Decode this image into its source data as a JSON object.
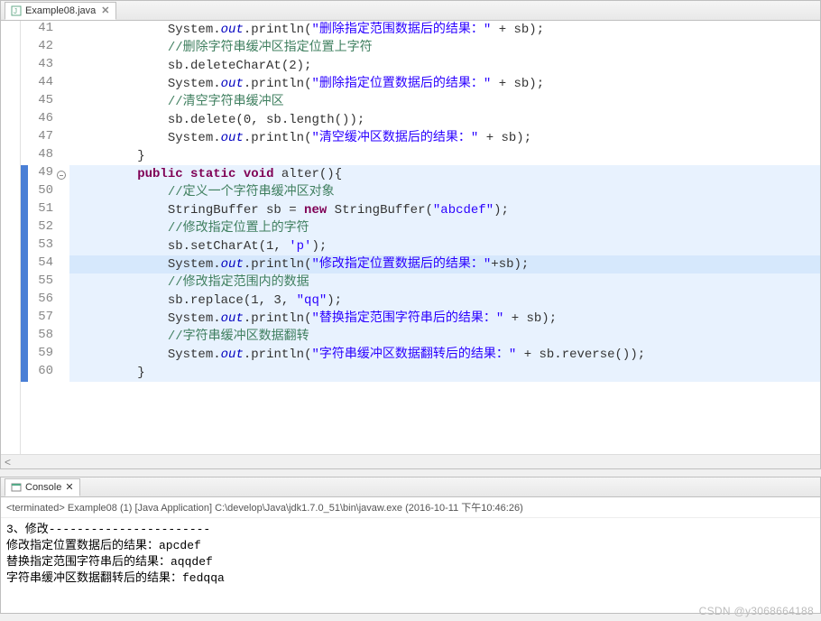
{
  "tab": {
    "filename": "Example08.java"
  },
  "code": {
    "startLine": 41,
    "highlightLines": [
      49,
      50,
      51,
      52,
      53,
      54,
      55,
      56,
      57,
      58,
      59,
      60
    ],
    "selectedLine": 54,
    "foldMarkerLine": 49,
    "lines": [
      {
        "n": 41,
        "seg": [
          {
            "t": "            System."
          },
          {
            "c": "fld",
            "t": "out"
          },
          {
            "t": ".println("
          },
          {
            "c": "str",
            "t": "\"删除指定范围数据后的结果：\""
          },
          {
            "t": " + sb);"
          }
        ]
      },
      {
        "n": 42,
        "seg": [
          {
            "t": "            "
          },
          {
            "c": "cmt",
            "t": "//删除字符串缓冲区指定位置上字符"
          }
        ]
      },
      {
        "n": 43,
        "seg": [
          {
            "t": "            sb.deleteCharAt(2);"
          }
        ]
      },
      {
        "n": 44,
        "seg": [
          {
            "t": "            System."
          },
          {
            "c": "fld",
            "t": "out"
          },
          {
            "t": ".println("
          },
          {
            "c": "str",
            "t": "\"删除指定位置数据后的结果：\""
          },
          {
            "t": " + sb);"
          }
        ]
      },
      {
        "n": 45,
        "seg": [
          {
            "t": "            "
          },
          {
            "c": "cmt",
            "t": "//清空字符串缓冲区"
          }
        ]
      },
      {
        "n": 46,
        "seg": [
          {
            "t": "            sb.delete(0, sb.length());"
          }
        ]
      },
      {
        "n": 47,
        "seg": [
          {
            "t": "            System."
          },
          {
            "c": "fld",
            "t": "out"
          },
          {
            "t": ".println("
          },
          {
            "c": "str",
            "t": "\"清空缓冲区数据后的结果：\""
          },
          {
            "t": " + sb);"
          }
        ]
      },
      {
        "n": 48,
        "seg": [
          {
            "t": "        }"
          }
        ]
      },
      {
        "n": 49,
        "seg": [
          {
            "t": "        "
          },
          {
            "c": "kw",
            "t": "public"
          },
          {
            "t": " "
          },
          {
            "c": "kw",
            "t": "static"
          },
          {
            "t": " "
          },
          {
            "c": "kw",
            "t": "void"
          },
          {
            "t": " alter(){"
          }
        ]
      },
      {
        "n": 50,
        "seg": [
          {
            "t": "            "
          },
          {
            "c": "cmt",
            "t": "//定义一个字符串缓冲区对象"
          }
        ]
      },
      {
        "n": 51,
        "seg": [
          {
            "t": "            StringBuffer sb = "
          },
          {
            "c": "kw",
            "t": "new"
          },
          {
            "t": " StringBuffer("
          },
          {
            "c": "str",
            "t": "\"abcdef\""
          },
          {
            "t": ");"
          }
        ]
      },
      {
        "n": 52,
        "seg": [
          {
            "t": "            "
          },
          {
            "c": "cmt",
            "t": "//修改指定位置上的字符"
          }
        ]
      },
      {
        "n": 53,
        "seg": [
          {
            "t": "            sb.setCharAt(1, "
          },
          {
            "c": "chr",
            "t": "'p'"
          },
          {
            "t": ");"
          }
        ]
      },
      {
        "n": 54,
        "seg": [
          {
            "t": "            System."
          },
          {
            "c": "fld",
            "t": "out"
          },
          {
            "t": ".println("
          },
          {
            "c": "str",
            "t": "\"修改指定位置数据后的结果：\""
          },
          {
            "t": "+sb);"
          }
        ]
      },
      {
        "n": 55,
        "seg": [
          {
            "t": "            "
          },
          {
            "c": "cmt",
            "t": "//修改指定范围内的数据"
          }
        ]
      },
      {
        "n": 56,
        "seg": [
          {
            "t": "            sb.replace(1, 3, "
          },
          {
            "c": "str",
            "t": "\"qq\""
          },
          {
            "t": ");"
          }
        ]
      },
      {
        "n": 57,
        "seg": [
          {
            "t": "            System."
          },
          {
            "c": "fld",
            "t": "out"
          },
          {
            "t": ".println("
          },
          {
            "c": "str",
            "t": "\"替换指定范围字符串后的结果：\""
          },
          {
            "t": " + sb);"
          }
        ]
      },
      {
        "n": 58,
        "seg": [
          {
            "t": "            "
          },
          {
            "c": "cmt",
            "t": "//字符串缓冲区数据翻转"
          }
        ]
      },
      {
        "n": 59,
        "seg": [
          {
            "t": "            System."
          },
          {
            "c": "fld",
            "t": "out"
          },
          {
            "t": ".println("
          },
          {
            "c": "str",
            "t": "\"字符串缓冲区数据翻转后的结果：\""
          },
          {
            "t": " + sb.reverse());"
          }
        ]
      },
      {
        "n": 60,
        "seg": [
          {
            "t": "        }"
          }
        ]
      }
    ]
  },
  "console": {
    "tabLabel": "Console",
    "status": "<terminated> Example08 (1) [Java Application] C:\\develop\\Java\\jdk1.7.0_51\\bin\\javaw.exe (2016-10-11 下午10:46:26)",
    "output": "3、修改-----------------------\n修改指定位置数据后的结果：apcdef\n替换指定范围字符串后的结果：aqqdef\n字符串缓冲区数据翻转后的结果：fedqqa"
  },
  "watermark": "CSDN @y3068664188"
}
